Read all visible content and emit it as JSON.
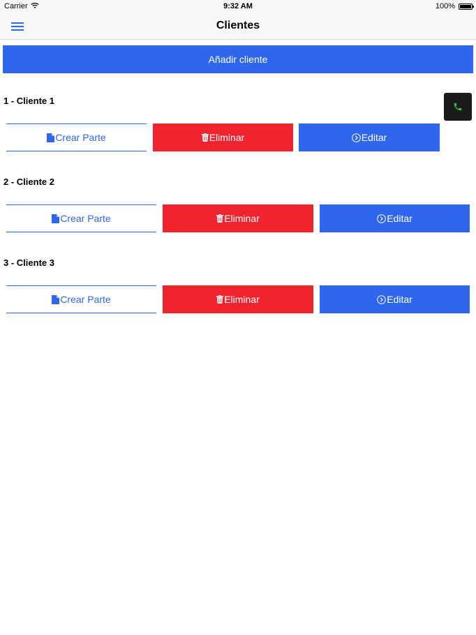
{
  "status_bar": {
    "carrier": "Carrier",
    "time": "9:32 AM",
    "battery": "100%"
  },
  "nav": {
    "title": "Clientes",
    "menu_icon": "hamburger-icon"
  },
  "add_button": {
    "label": "Añadir cliente"
  },
  "floating": {
    "icon": "phone-icon"
  },
  "clients": [
    {
      "name": "1 - Cliente 1",
      "create_label": "Crear Parte",
      "delete_label": "Eliminar",
      "edit_label": "Editar"
    },
    {
      "name": "2 - Cliente 2",
      "create_label": "Crear Parte",
      "delete_label": "Eliminar",
      "edit_label": "Editar"
    },
    {
      "name": "3 - Cliente 3",
      "create_label": "Crear Parte",
      "delete_label": "Eliminar",
      "edit_label": "Editar"
    }
  ],
  "colors": {
    "accent": "#2f66ee",
    "danger": "#f0242f",
    "call": "#1a1a1a",
    "call_icon": "#33cc33"
  }
}
